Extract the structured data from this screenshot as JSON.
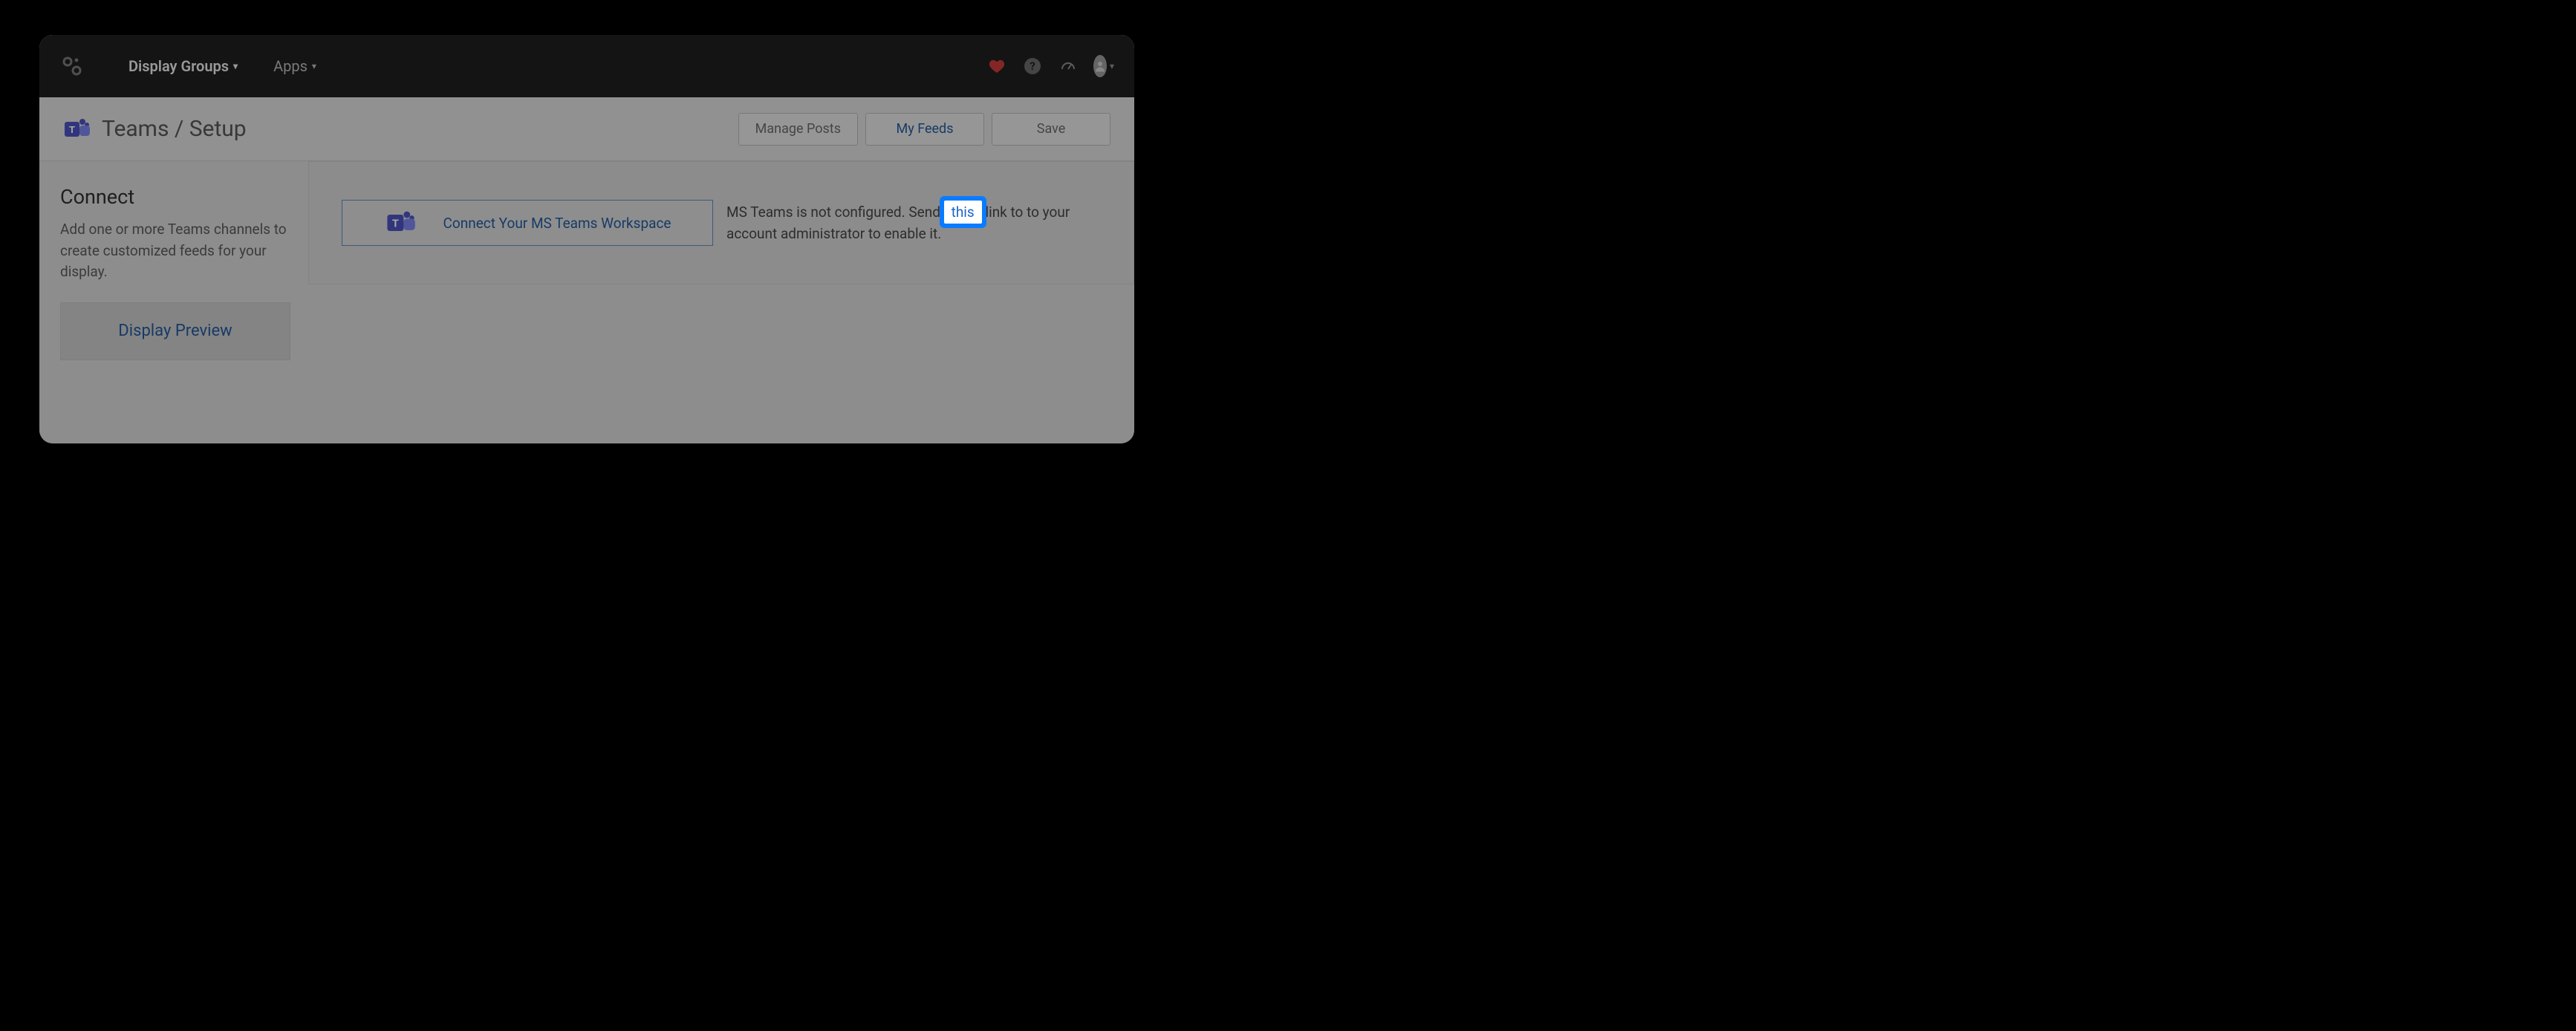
{
  "nav": {
    "display_groups": "Display Groups",
    "apps": "Apps"
  },
  "page": {
    "title": "Teams / Setup"
  },
  "actions": {
    "manage_posts": "Manage Posts",
    "my_feeds": "My Feeds",
    "save": "Save"
  },
  "sidebar": {
    "title": "Connect",
    "description": "Add one or more Teams channels to create customized feeds for your display.",
    "preview_label": "Display Preview"
  },
  "content": {
    "connect_label": "Connect Your MS Teams Workspace",
    "status_before": "MS Teams is not configured. Send ",
    "status_link": "this",
    "status_after": " link to to your account administrator to enable it."
  },
  "icons": {
    "heart": "heart-icon",
    "help": "?",
    "dashboard": "dashboard-icon",
    "avatar": "avatar-icon"
  }
}
